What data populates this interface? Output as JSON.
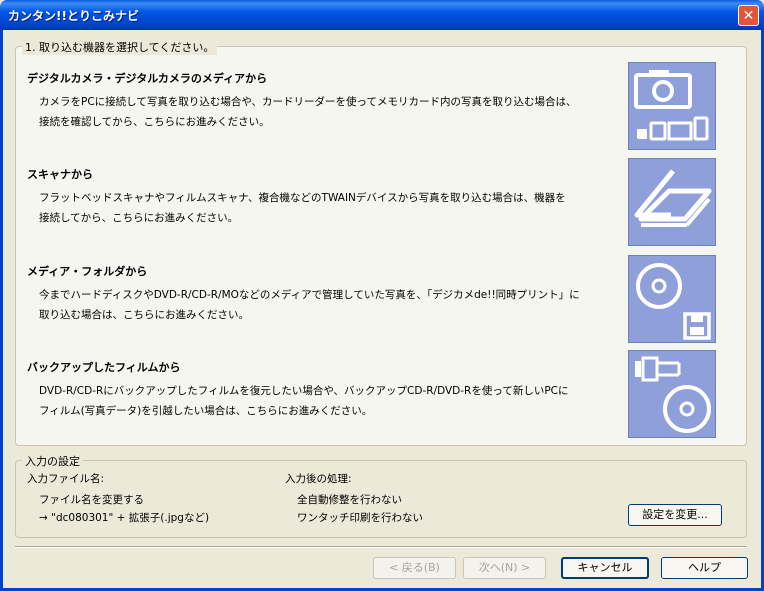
{
  "window": {
    "title": "カンタン!!とりこみナビ",
    "close_label": "✕"
  },
  "select_group": {
    "legend": "1. 取り込む機器を選択してください。",
    "sections": [
      {
        "title": "デジタルカメラ・デジタルカメラのメディアから",
        "desc1": "カメラをPCに接続して写真を取り込む場合や、カードリーダーを使ってメモリカード内の写真を取り込む場合は、",
        "desc2": "接続を確認してから、こちらにお進みください。",
        "icon": "camera-icon"
      },
      {
        "title": "スキャナから",
        "desc1": "フラットベッドスキャナやフィルムスキャナ、複合機などのTWAINデバイスから写真を取り込む場合は、機器を",
        "desc2": "接続してから、こちらにお進みください。",
        "icon": "scanner-icon"
      },
      {
        "title": "メディア・フォルダから",
        "desc1": "今までハードディスクやDVD-R/CD-R/MOなどのメディアで管理していた写真を、「デジカメde!!同時プリント」に",
        "desc2": "取り込む場合は、こちらにお進みください。",
        "icon": "disc-media-icon"
      },
      {
        "title": "バックアップしたフィルムから",
        "desc1": "DVD-R/CD-Rにバックアップしたフィルムを復元したい場合や、バックアップCD-R/DVD-Rを使って新しいPCに",
        "desc2": "フィルム(写真データ)を引越したい場合は、こちらにお進みください。",
        "icon": "film-disc-icon"
      }
    ]
  },
  "input_settings": {
    "legend": "入力の設定",
    "filename_label": "入力ファイル名:",
    "filename_line1": "ファイル名を変更する",
    "filename_line2": "→ \"dc080301\" + 拡張子(.jpgなど)",
    "post_label": "入力後の処理:",
    "post_line1": "全自動修整を行わない",
    "post_line2": "ワンタッチ印刷を行わない",
    "change_button": "設定を変更..."
  },
  "footer": {
    "back": "< 戻る(B)",
    "next": "次へ(N) >",
    "cancel": "キャンセル",
    "help": "ヘルプ"
  },
  "colors": {
    "titlebar": "#0055E5",
    "icon_bg": "#8F9FD9",
    "dialog_bg": "#ECE9D8"
  }
}
